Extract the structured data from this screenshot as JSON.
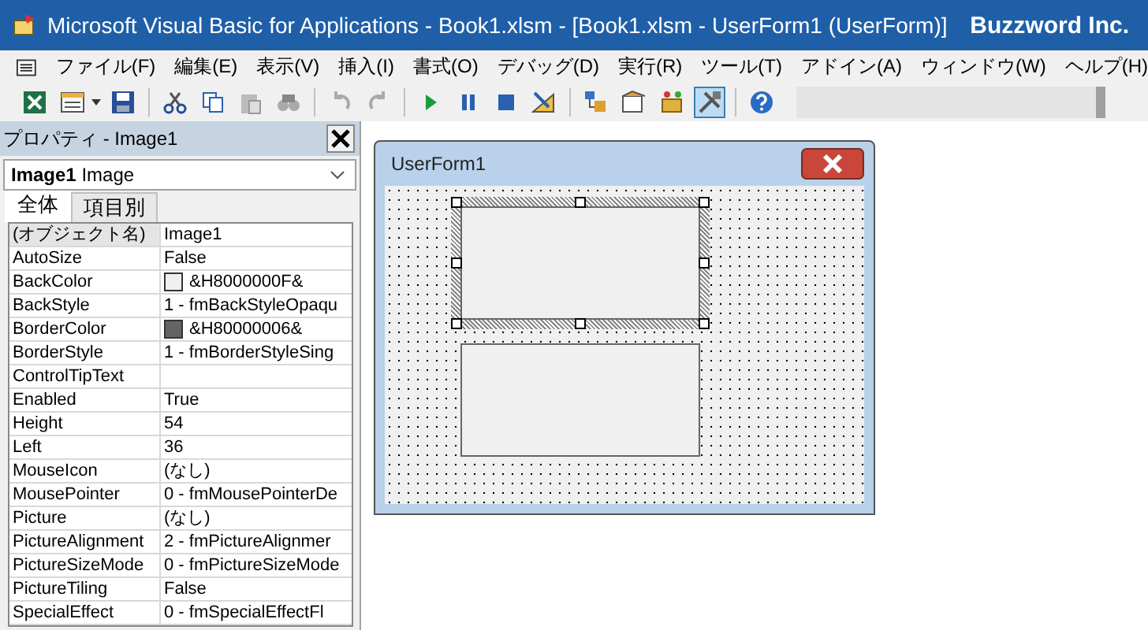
{
  "window": {
    "title": "Microsoft Visual Basic for Applications - Book1.xlsm - [Book1.xlsm - UserForm1 (UserForm)]",
    "brand": "Buzzword Inc."
  },
  "menu": [
    "ファイル(F)",
    "編集(E)",
    "表示(V)",
    "挿入(I)",
    "書式(O)",
    "デバッグ(D)",
    "実行(R)",
    "ツール(T)",
    "アドイン(A)",
    "ウィンドウ(W)",
    "ヘルプ(H)"
  ],
  "toolbar": [
    {
      "buttons": [
        {
          "kind": "excel",
          "selected": false
        },
        {
          "kind": "form",
          "selected": false
        },
        {
          "kind": "save",
          "selected": false
        }
      ]
    },
    {
      "buttons": [
        {
          "kind": "cut",
          "selected": false
        },
        {
          "kind": "copy",
          "selected": false
        },
        {
          "kind": "paste",
          "selected": false
        },
        {
          "kind": "find",
          "selected": false
        }
      ]
    },
    {
      "buttons": [
        {
          "kind": "undo",
          "selected": false
        },
        {
          "kind": "redo",
          "selected": false
        }
      ]
    },
    {
      "buttons": [
        {
          "kind": "run",
          "selected": false
        },
        {
          "kind": "pause",
          "selected": false
        },
        {
          "kind": "stop",
          "selected": false
        },
        {
          "kind": "design",
          "selected": false
        }
      ]
    },
    {
      "buttons": [
        {
          "kind": "explorer",
          "selected": false
        },
        {
          "kind": "props",
          "selected": false
        },
        {
          "kind": "browser",
          "selected": false
        },
        {
          "kind": "toolbox",
          "selected": true
        }
      ]
    },
    {
      "buttons": [
        {
          "kind": "help",
          "selected": false
        }
      ]
    }
  ],
  "properties": {
    "title": "プロパティ - Image1",
    "object_name": "Image1",
    "object_type": "Image",
    "tabs": [
      {
        "label": "全体",
        "selected": true
      },
      {
        "label": "項目別",
        "selected": false
      }
    ],
    "rows": [
      {
        "name": "(オブジェクト名)",
        "value": "Image1",
        "selected": true
      },
      {
        "name": "AutoSize",
        "value": "False",
        "selected": false
      },
      {
        "name": "BackColor",
        "value": "&H8000000F&",
        "color": "#f0f0f0",
        "selected": false
      },
      {
        "name": "BackStyle",
        "value": "1 - fmBackStyleOpaqu",
        "selected": false
      },
      {
        "name": "BorderColor",
        "value": "&H80000006&",
        "color": "#646464",
        "selected": false
      },
      {
        "name": "BorderStyle",
        "value": "1 - fmBorderStyleSing",
        "selected": false
      },
      {
        "name": "ControlTipText",
        "value": "",
        "selected": false
      },
      {
        "name": "Enabled",
        "value": "True",
        "selected": false
      },
      {
        "name": "Height",
        "value": "54",
        "selected": false
      },
      {
        "name": "Left",
        "value": "36",
        "selected": false
      },
      {
        "name": "MouseIcon",
        "value": "(なし)",
        "selected": false
      },
      {
        "name": "MousePointer",
        "value": "0 - fmMousePointerDe",
        "selected": false
      },
      {
        "name": "Picture",
        "value": "(なし)",
        "selected": false
      },
      {
        "name": "PictureAlignment",
        "value": "2 - fmPictureAlignmer",
        "selected": false
      },
      {
        "name": "PictureSizeMode",
        "value": "0 - fmPictureSizeMode",
        "selected": false
      },
      {
        "name": "PictureTiling",
        "value": "False",
        "selected": false
      },
      {
        "name": "SpecialEffect",
        "value": "0 - fmSpecialEffectFl",
        "selected": false
      }
    ]
  },
  "userform": {
    "title": "UserForm1",
    "controls": [
      {
        "selected": true
      },
      {
        "selected": false
      }
    ]
  }
}
